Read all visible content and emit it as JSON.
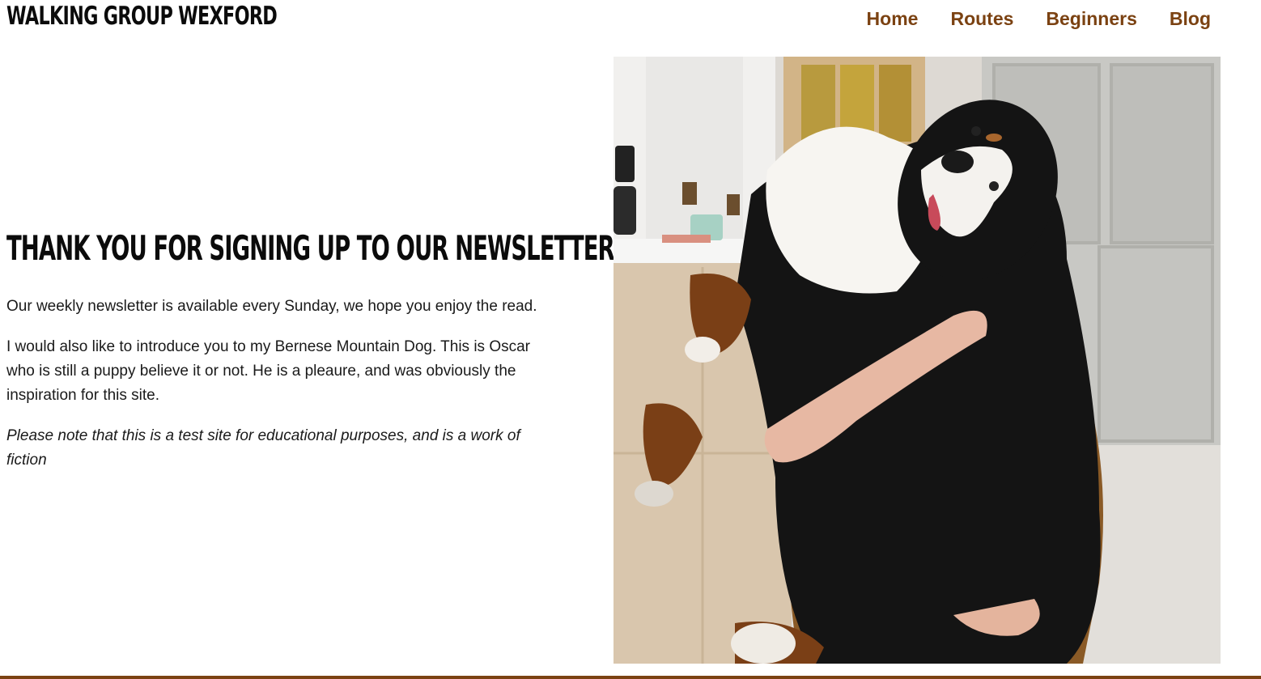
{
  "header": {
    "brand": "WALKING GROUP WEXFORD",
    "nav": [
      {
        "label": "Home"
      },
      {
        "label": "Routes"
      },
      {
        "label": "Beginners"
      },
      {
        "label": "Blog"
      }
    ]
  },
  "main": {
    "headline": "THANK YOU FOR SIGNING UP TO OUR NEWSLETTER",
    "paragraphs": [
      "Our weekly newsletter is available every Sunday, we hope you enjoy the read.",
      "I would also like to introduce you to my Bernese Mountain Dog. This is Oscar who is still a puppy believe it or not. He is a pleaure, and was obviously the inspiration for this site.",
      "Please note that this is a test site for educational purposes, and is a work of fiction"
    ],
    "image": {
      "subject": "bernese-mountain-dog-photo"
    }
  },
  "colors": {
    "accent": "#7b4212",
    "text": "#111111",
    "background": "#ffffff"
  }
}
